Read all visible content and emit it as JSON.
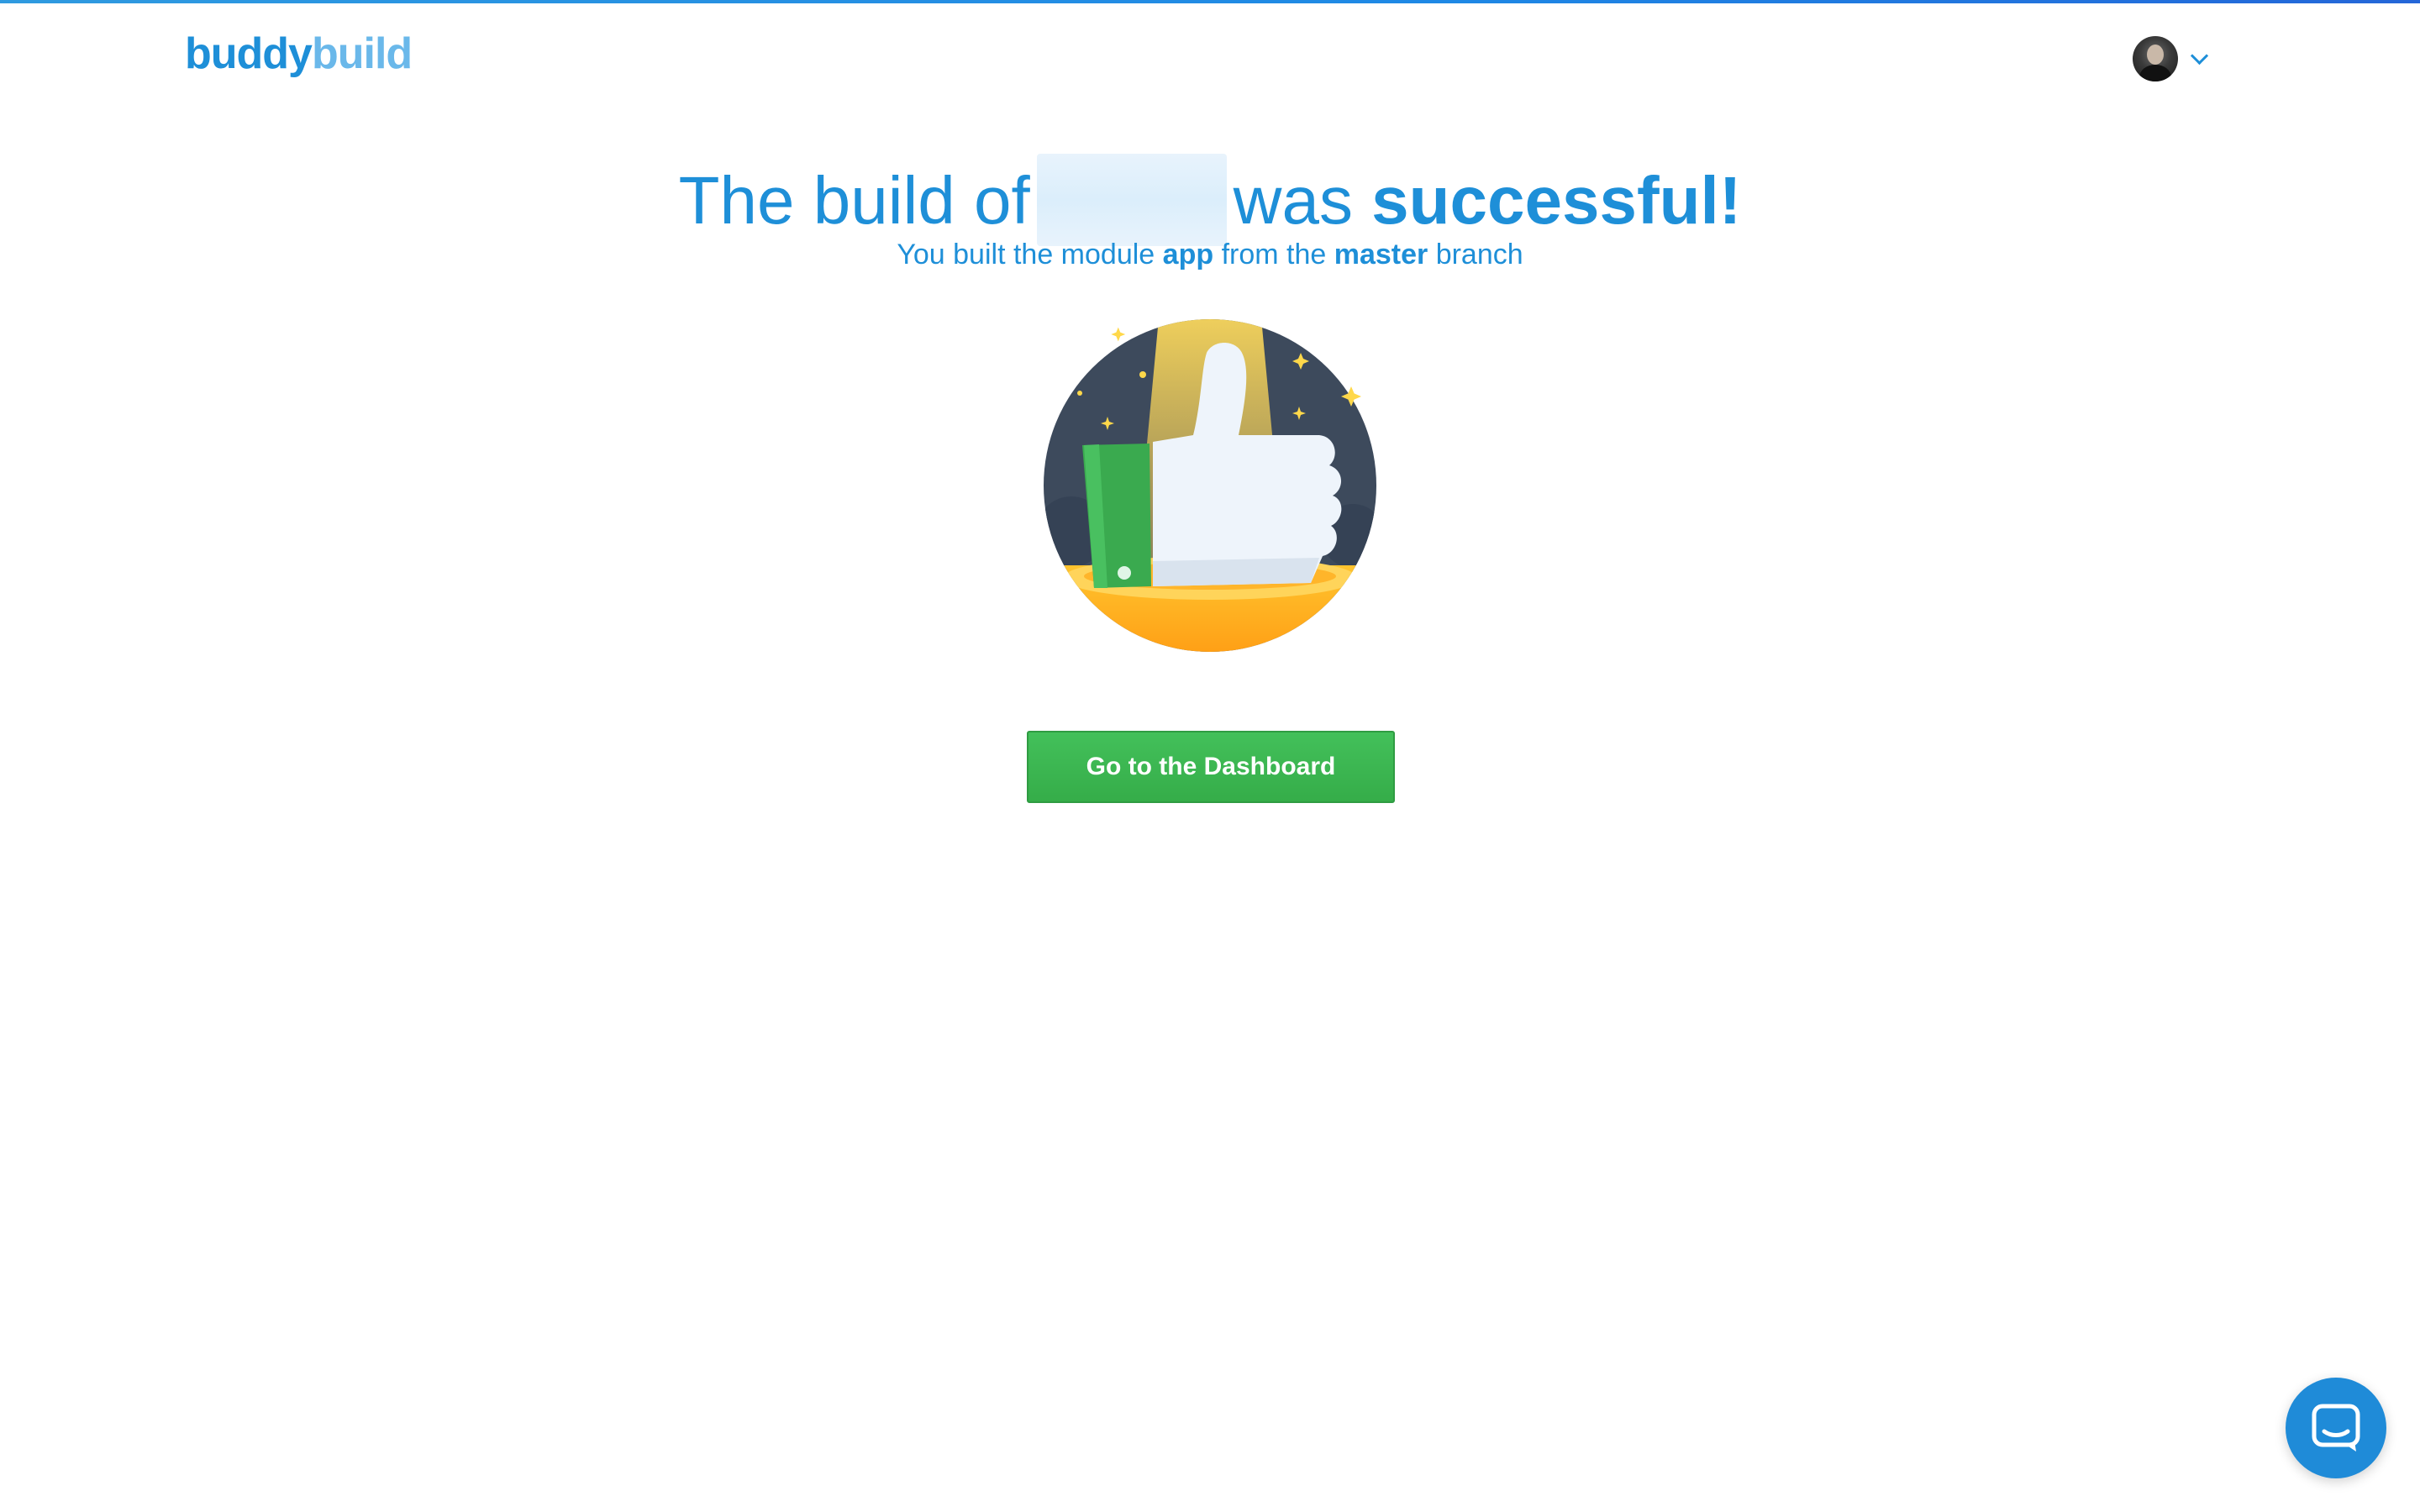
{
  "header": {
    "logo_part1": "buddy",
    "logo_part2": "build",
    "user_menu_icon": "chevron-down-icon"
  },
  "headline": {
    "prefix": "The build of",
    "middle": "was",
    "emphasis": "successful!"
  },
  "subline": {
    "text1": "You built the module",
    "module": "app",
    "text2": "from the",
    "branch": "master",
    "text3": "branch"
  },
  "illustration": {
    "icon": "thumbs-up-icon"
  },
  "actions": {
    "dashboard_label": "Go to the Dashboard"
  },
  "chat": {
    "icon": "chat-icon"
  },
  "colors": {
    "brand_blue": "#1e8fd8",
    "brand_light_blue": "#6ab8ea",
    "button_green": "#3cb552",
    "chat_blue": "#1f8bd8"
  }
}
